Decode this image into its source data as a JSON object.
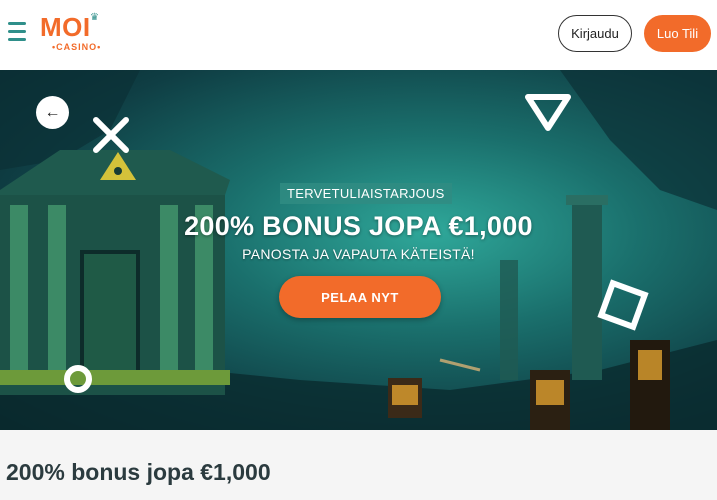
{
  "header": {
    "menu_icon": "hamburger-menu-icon",
    "logo": {
      "main": "MOI",
      "sub": "•CASINO•"
    },
    "login_label": "Kirjaudu",
    "signup_label": "Luo Tili"
  },
  "hero": {
    "back_icon": "arrow-left-icon",
    "tag": "TERVETULIAISTARJOUS",
    "title": "200% BONUS JOPA €1,000",
    "subtitle": "PANOSTA JA VAPAUTA KÄTEISTÄ!",
    "cta_label": "PELAA NYT"
  },
  "section": {
    "title": "200% bonus jopa €1,000"
  },
  "colors": {
    "brand_orange": "#f26b2a",
    "brand_teal": "#2f8f8a",
    "hero_bg": "#1a6f6c"
  }
}
